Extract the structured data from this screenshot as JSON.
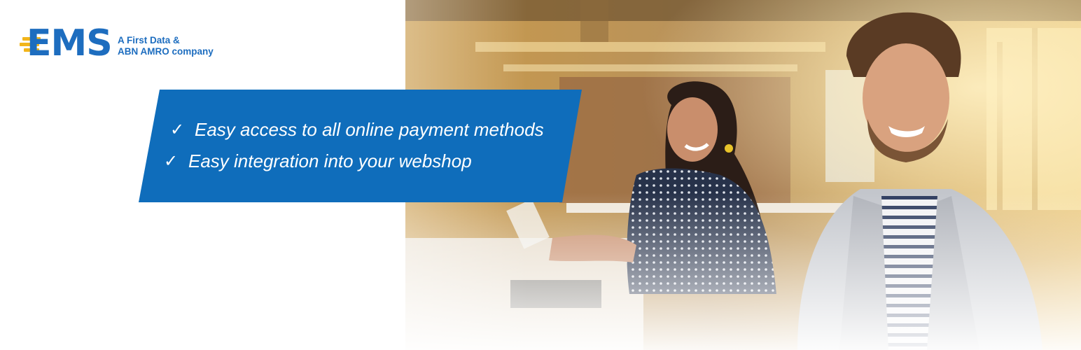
{
  "brand": {
    "logo_text": "EMS",
    "tagline_line1": "A First Data &",
    "tagline_line2": "ABN AMRO company",
    "colors": {
      "brand_blue": "#1d6dbf",
      "brand_yellow": "#f2b51b",
      "panel_blue": "#0f6dbb"
    }
  },
  "features": {
    "check_icon": "✓",
    "items": [
      {
        "icon": "check-icon",
        "label": "Easy access to all online payment methods"
      },
      {
        "icon": "check-icon",
        "label": "Easy integration into your webshop"
      }
    ]
  }
}
